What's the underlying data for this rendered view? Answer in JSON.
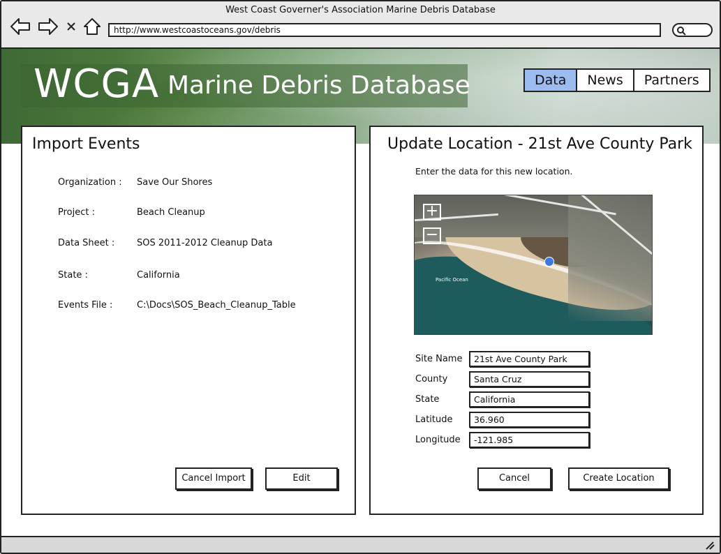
{
  "window": {
    "title": "West Coast Governer's Association Marine Debris Database"
  },
  "browser": {
    "url": "http://www.westcoastoceans.gov/debris"
  },
  "header": {
    "brand": "WCGA",
    "subtitle": "Marine Debris Database",
    "nav": [
      {
        "label": "Data",
        "active": true
      },
      {
        "label": "News",
        "active": false
      },
      {
        "label": "Partners",
        "active": false
      }
    ]
  },
  "import_panel": {
    "title": "Import Events",
    "fields": [
      {
        "label": "Organization :",
        "value": "Save Our Shores"
      },
      {
        "label": "Project :",
        "value": "Beach Cleanup"
      },
      {
        "label": "Data Sheet :",
        "value": "SOS 2011-2012 Cleanup Data"
      },
      {
        "label": "State :",
        "value": "California"
      },
      {
        "label": "Events File :",
        "value": "C:\\Docs\\SOS_Beach_Cleanup_Table"
      }
    ],
    "cancel_label": "Cancel Import",
    "edit_label": "Edit"
  },
  "update_panel": {
    "title": "Update Location - 21st Ave County Park",
    "intro": "Enter the data for this new location.",
    "map": {
      "zoom_in": "+",
      "zoom_out": "−",
      "label": "Pacific Ocean",
      "pin_color": "#3a78e6"
    },
    "fields": [
      {
        "label": "Site Name",
        "value": "21st Ave County Park"
      },
      {
        "label": "County",
        "value": "Santa Cruz"
      },
      {
        "label": "State",
        "value": "California"
      },
      {
        "label": "Latitude",
        "value": "36.960"
      },
      {
        "label": "Longitude",
        "value": "-121.985"
      }
    ],
    "cancel_label": "Cancel",
    "create_label": "Create Location"
  },
  "colors": {
    "active_tab": "#9cbcf0",
    "border": "#222222"
  }
}
